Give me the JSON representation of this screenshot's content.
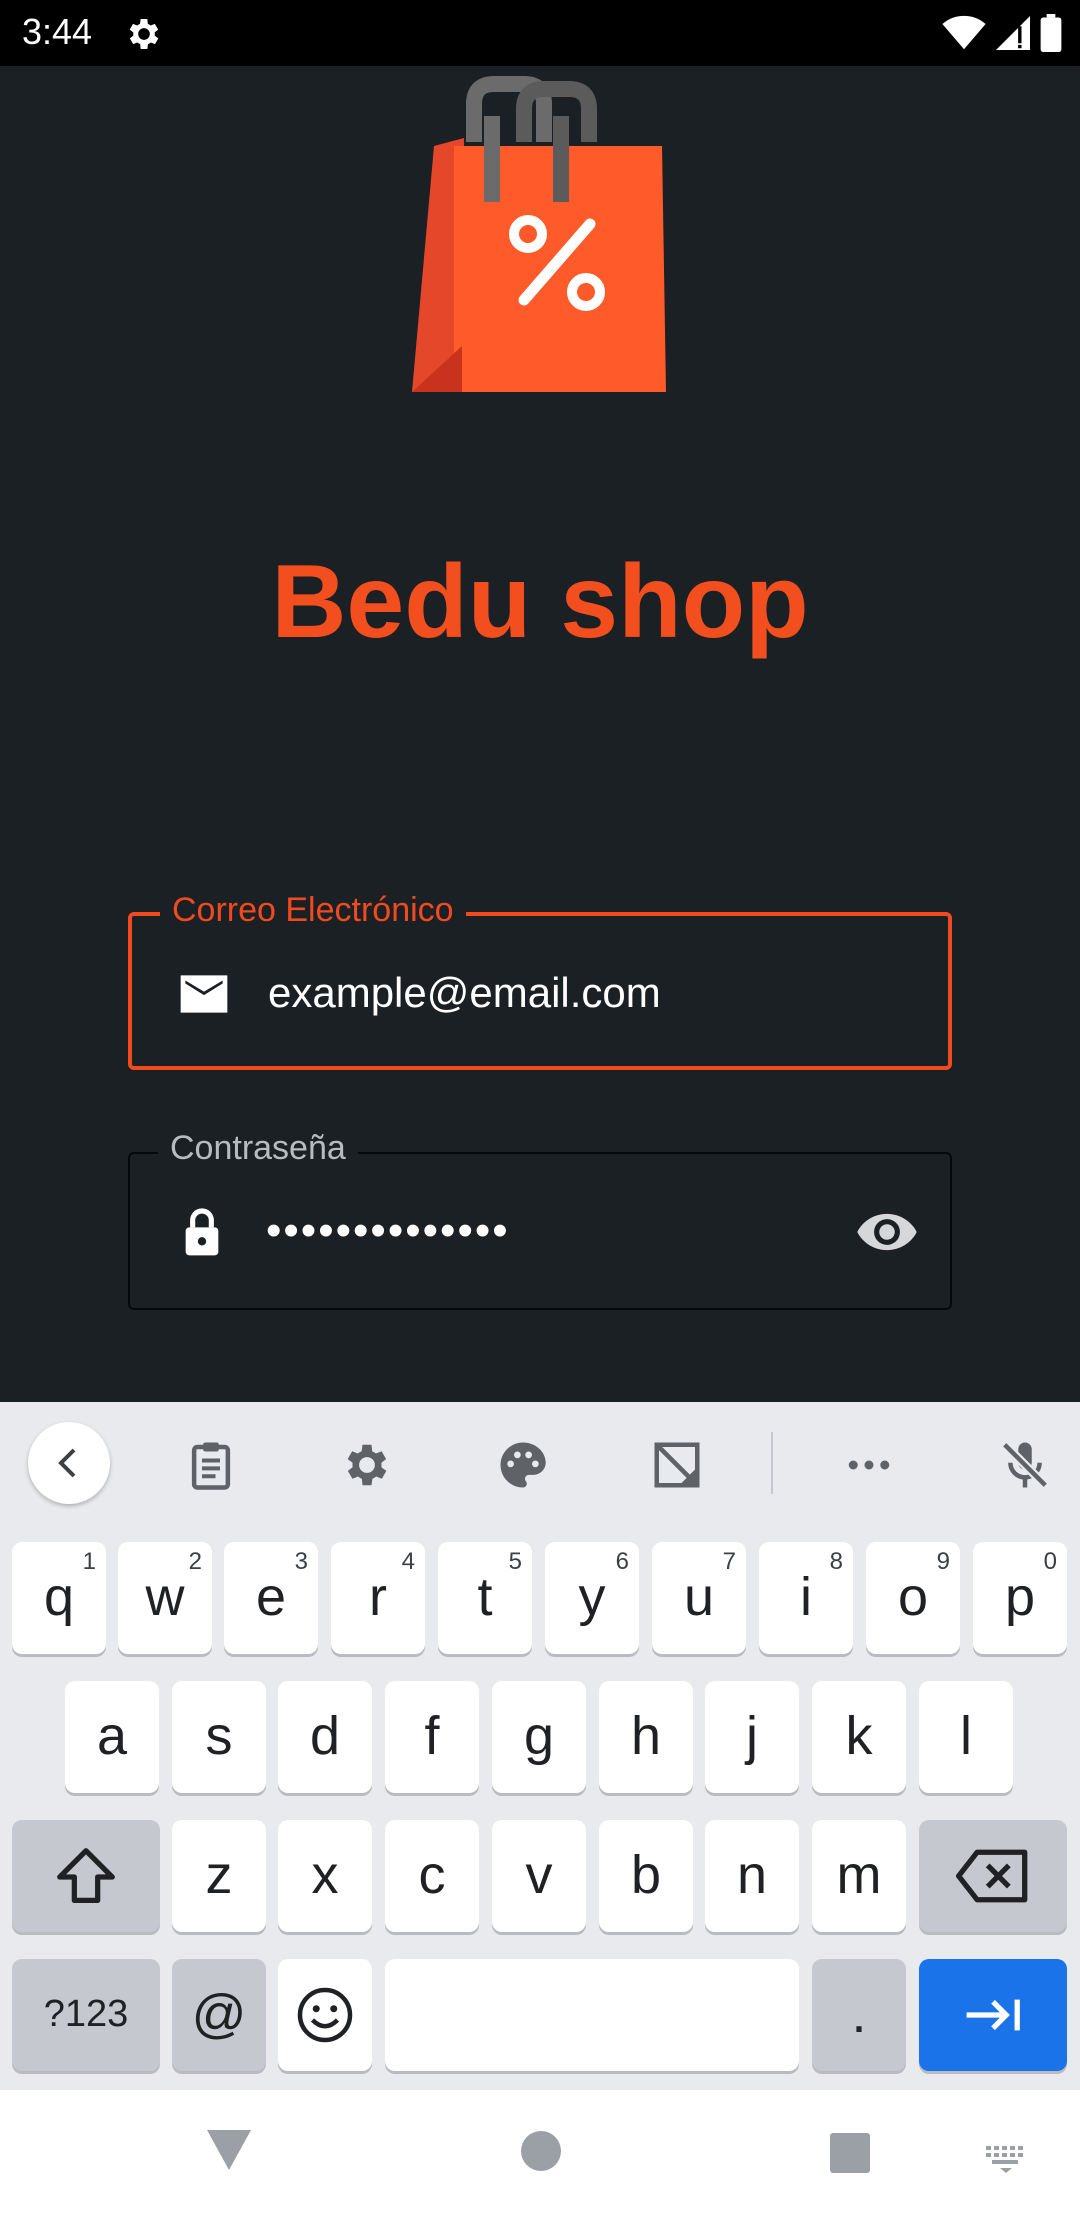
{
  "status_bar": {
    "time": "3:44",
    "icons": [
      "gear-icon",
      "wifi-icon",
      "signal-icon",
      "battery-icon"
    ]
  },
  "app": {
    "brand_title": "Bedu shop",
    "logo_icon": "shopping-bag-percent-icon",
    "accent_color": "#f24e1e",
    "email_field": {
      "label": "Correo Electrónico",
      "value": "example@email.com",
      "icon": "mail-icon"
    },
    "password_field": {
      "label": "Contraseña",
      "value": "••••••••••••••",
      "icon": "lock-icon",
      "toggle_icon": "eye-icon"
    }
  },
  "keyboard": {
    "toolbar_icons": [
      "chevron-left-icon",
      "clipboard-icon",
      "settings-icon",
      "palette-icon",
      "resize-icon",
      "more-icon",
      "mic-off-icon"
    ],
    "row1": [
      {
        "key": "q",
        "hint": "1"
      },
      {
        "key": "w",
        "hint": "2"
      },
      {
        "key": "e",
        "hint": "3"
      },
      {
        "key": "r",
        "hint": "4"
      },
      {
        "key": "t",
        "hint": "5"
      },
      {
        "key": "y",
        "hint": "6"
      },
      {
        "key": "u",
        "hint": "7"
      },
      {
        "key": "i",
        "hint": "8"
      },
      {
        "key": "o",
        "hint": "9"
      },
      {
        "key": "p",
        "hint": "0"
      }
    ],
    "row2": [
      "a",
      "s",
      "d",
      "f",
      "g",
      "h",
      "j",
      "k",
      "l"
    ],
    "row3": [
      "z",
      "x",
      "c",
      "v",
      "b",
      "n",
      "m"
    ],
    "symbols_key": "?123",
    "at_key": "@",
    "period_key": ".",
    "enter_color": "#1a73e8"
  },
  "navbar": {
    "icons": [
      "back-triangle-icon",
      "home-circle-icon",
      "recents-square-icon",
      "keyboard-switch-icon"
    ]
  }
}
